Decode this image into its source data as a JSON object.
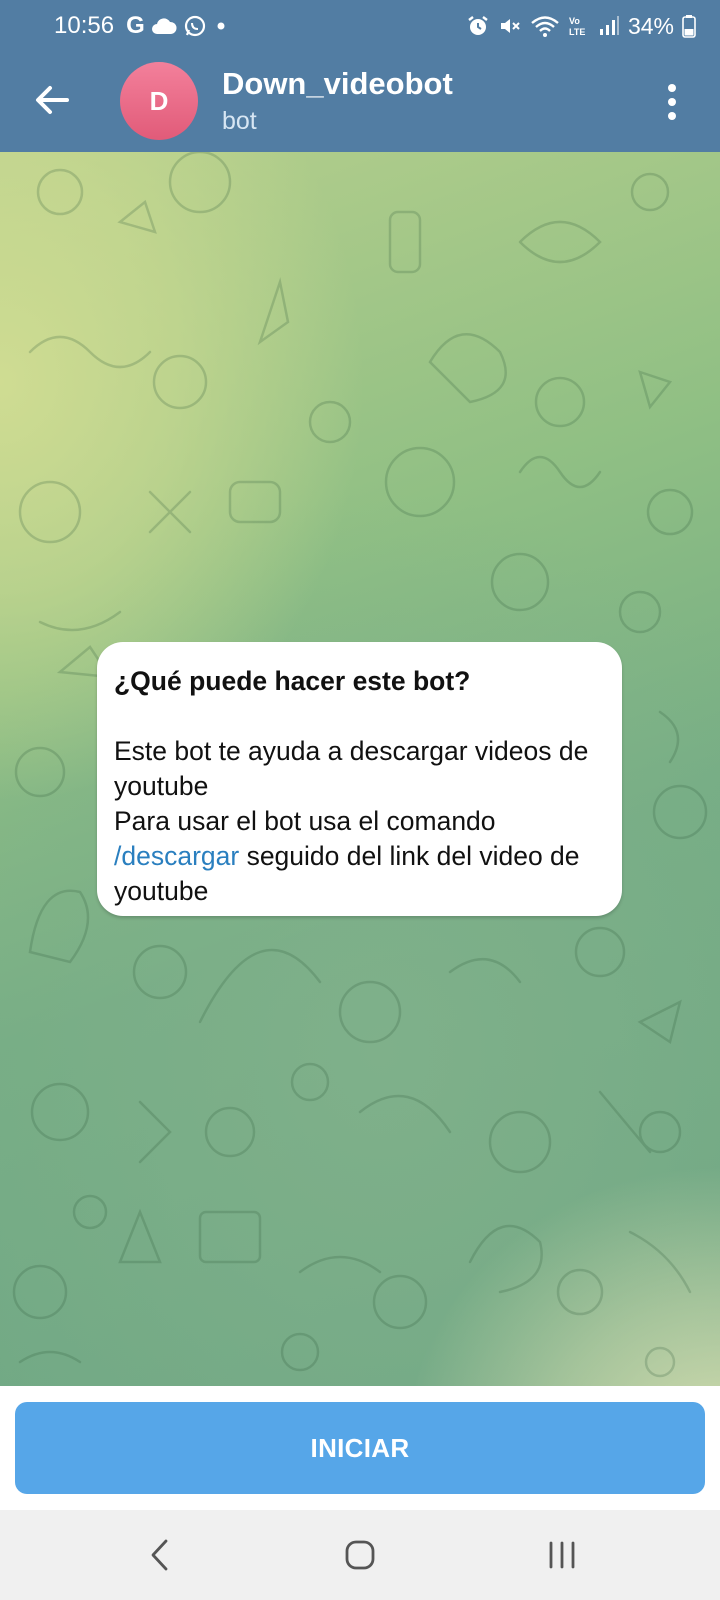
{
  "status_bar": {
    "time": "10:56",
    "left_icons": [
      "google-g-icon",
      "cloud-icon",
      "whatsapp-icon",
      "dot-icon"
    ],
    "right_icons": [
      "alarm-icon",
      "mute-icon",
      "wifi-icon",
      "volte-icon",
      "signal-icon"
    ],
    "battery": "34%"
  },
  "header": {
    "avatar_letter": "D",
    "avatar_color": "#e8667f",
    "title": "Down_videobot",
    "subtitle": "bot"
  },
  "message": {
    "heading": "¿Qué puede hacer este bot?",
    "line1": "Este bot te ayuda a descargar videos de youtube",
    "line2_before": "Para usar el bot usa el comando ",
    "line2_link": "/descargar",
    "line2_after": " seguido del link del video de youtube"
  },
  "start_button": {
    "label": "INICIAR",
    "color": "#56a6e8"
  },
  "nav_bar": {
    "icons": [
      "back-nav-icon",
      "home-nav-icon",
      "recents-nav-icon"
    ]
  },
  "colors": {
    "header": "#527da3",
    "link": "#2a7fbf"
  }
}
